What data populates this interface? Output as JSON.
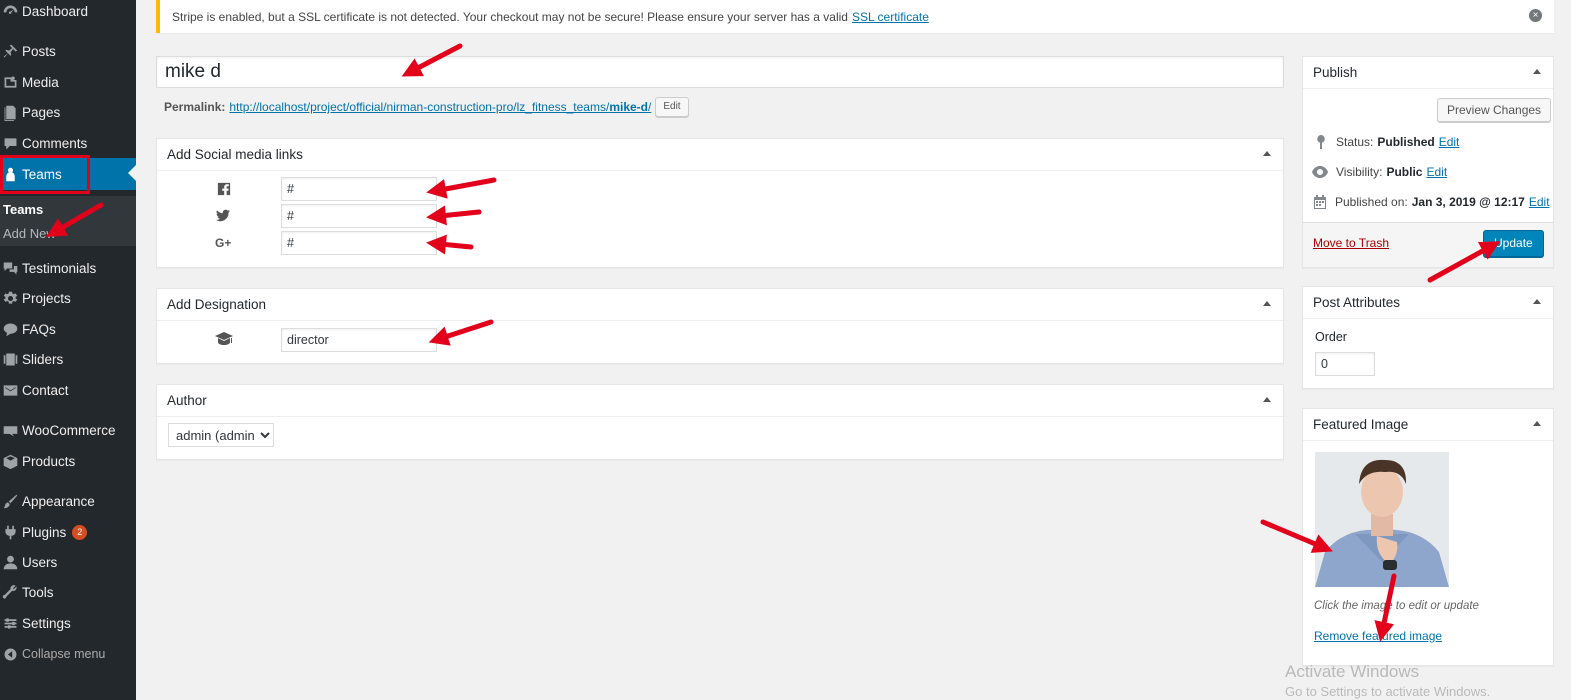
{
  "sidebar": {
    "items": [
      {
        "key": "dashboard",
        "label": "Dashboard",
        "icon": "dashboard-icon"
      },
      {
        "key": "posts",
        "label": "Posts",
        "icon": "pin-icon"
      },
      {
        "key": "media",
        "label": "Media",
        "icon": "media-icon"
      },
      {
        "key": "pages",
        "label": "Pages",
        "icon": "pages-icon"
      },
      {
        "key": "comments",
        "label": "Comments",
        "icon": "comment-icon"
      },
      {
        "key": "teams",
        "label": "Teams",
        "icon": "team-icon"
      },
      {
        "key": "testimonials",
        "label": "Testimonials",
        "icon": "testimonial-icon"
      },
      {
        "key": "projects",
        "label": "Projects",
        "icon": "gear-icon"
      },
      {
        "key": "faqs",
        "label": "FAQs",
        "icon": "chat-icon"
      },
      {
        "key": "sliders",
        "label": "Sliders",
        "icon": "slides-icon"
      },
      {
        "key": "contact",
        "label": "Contact",
        "icon": "mail-icon"
      },
      {
        "key": "woocommerce",
        "label": "WooCommerce",
        "icon": "woo-icon"
      },
      {
        "key": "products",
        "label": "Products",
        "icon": "box-icon"
      },
      {
        "key": "appearance",
        "label": "Appearance",
        "icon": "brush-icon"
      },
      {
        "key": "plugins",
        "label": "Plugins",
        "icon": "plug-icon",
        "badge": "2"
      },
      {
        "key": "users",
        "label": "Users",
        "icon": "user-icon"
      },
      {
        "key": "tools",
        "label": "Tools",
        "icon": "wrench-icon"
      },
      {
        "key": "settings",
        "label": "Settings",
        "icon": "settings-icon"
      }
    ],
    "submenu": {
      "current": "Teams",
      "add_new": "Add New"
    },
    "collapse": "Collapse menu"
  },
  "notice": {
    "text": "Stripe is enabled, but a SSL certificate is not detected. Your checkout may not be secure! Please ensure your server has a valid",
    "link": "SSL certificate",
    "close": "×"
  },
  "editor": {
    "title_value": "mike d",
    "permalink_label": "Permalink:",
    "permalink_base": "http://localhost/project/official/nirman-construction-pro/lz_fitness_teams/",
    "permalink_slug": "mike-d",
    "permalink_edit": "Edit"
  },
  "social_box": {
    "title": "Add Social media links",
    "fields": [
      {
        "icon": "facebook-icon",
        "value": "#"
      },
      {
        "icon": "twitter-icon",
        "value": "#"
      },
      {
        "icon": "google-plus-icon",
        "value": "#"
      }
    ]
  },
  "designation_box": {
    "title": "Add Designation",
    "value": "director",
    "icon": "graduation-cap-icon"
  },
  "author_box": {
    "title": "Author",
    "selected": "admin (admin)"
  },
  "publish": {
    "title": "Publish",
    "preview": "Preview Changes",
    "status_label": "Status:",
    "status_value": "Published",
    "visibility_label": "Visibility:",
    "visibility_value": "Public",
    "published_label": "Published on:",
    "published_value": "Jan 3, 2019 @ 12:17",
    "edit": "Edit",
    "trash": "Move to Trash",
    "update": "Update"
  },
  "attributes": {
    "title": "Post Attributes",
    "order_label": "Order",
    "order_value": "0"
  },
  "featured": {
    "title": "Featured Image",
    "hint": "Click the image to edit or update",
    "remove": "Remove featured image"
  },
  "watermark": {
    "line1": "Activate Windows",
    "line2": "Go to Settings to activate Windows."
  },
  "colors": {
    "sidebar_bg": "#23282d",
    "accent": "#0073aa",
    "highlight": "#e3001b",
    "arrow": "#e3001b",
    "primary_btn": "#0085ba"
  }
}
